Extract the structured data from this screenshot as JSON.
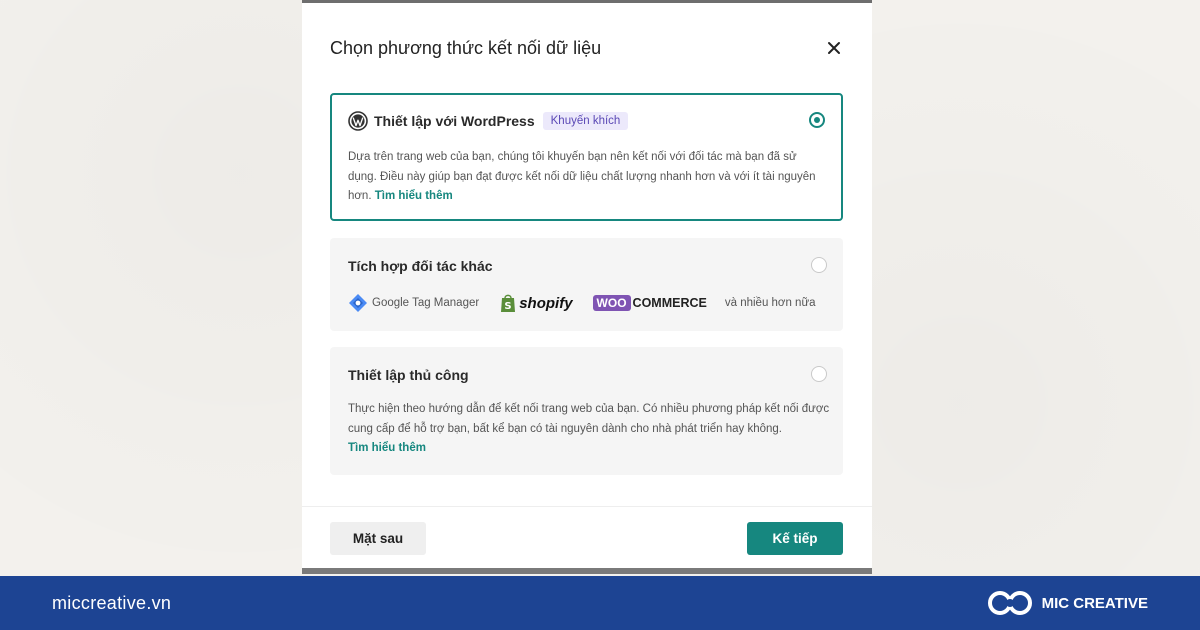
{
  "modal": {
    "title": "Chọn phương thức kết nối dữ liệu",
    "close_icon": "close-icon"
  },
  "options": [
    {
      "title": "Thiết lập với WordPress",
      "badge": "Khuyến khích",
      "icon": "wordpress-icon",
      "selected": true,
      "description": "Dựa trên trang web của bạn, chúng tôi khuyến bạn nên kết nối với đối tác mà bạn đã sử dụng. Điều này giúp bạn đạt được kết nối dữ liệu chất lượng nhanh hơn và với ít tài nguyên hơn.",
      "link": "Tìm hiểu thêm"
    },
    {
      "title": "Tích hợp đối tác khác",
      "selected": false,
      "partners": [
        "Google Tag Manager",
        "shopify",
        "WOO",
        "COMMERCE"
      ],
      "more": "và nhiều hơn nữa"
    },
    {
      "title": "Thiết lập thủ công",
      "selected": false,
      "description": "Thực hiện theo hướng dẫn để kết nối trang web của bạn. Có nhiều phương pháp kết nối được cung cấp để hỗ trợ bạn, bất kể bạn có tài nguyên dành cho nhà phát triển hay không.",
      "link": "Tìm hiểu thêm"
    }
  ],
  "footer": {
    "back_label": "Mặt sau",
    "next_label": "Kế tiếp"
  },
  "brand": {
    "url": "miccreative.vn",
    "name": "MIC CREATIVE"
  },
  "colors": {
    "accent": "#16877f",
    "badge_text": "#5a48b5",
    "brand_bar": "#1d4493",
    "woo_purple": "#7f54b3"
  }
}
